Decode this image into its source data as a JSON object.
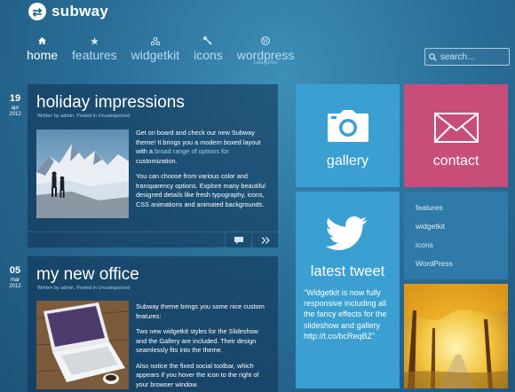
{
  "brand": {
    "name": "subway",
    "icon": "arrows-icon"
  },
  "nav": [
    {
      "label": "home",
      "sub": "",
      "icon": "home-icon"
    },
    {
      "label": "features",
      "sub": "",
      "icon": "star-icon"
    },
    {
      "label": "widgetkit",
      "sub": "",
      "icon": "widgetkit-icon"
    },
    {
      "label": "icons",
      "sub": "",
      "icon": "tools-icon"
    },
    {
      "label": "wordpress",
      "sub": "categories",
      "icon": "wordpress-icon"
    }
  ],
  "search": {
    "placeholder": "search..."
  },
  "posts": [
    {
      "day": "19",
      "month": "apr",
      "year": "2012",
      "title": "holiday impressions",
      "meta": "Written by admin. Posted in Uncategorized",
      "p1_a": "Get on board and check our new Subway theme! It brings you a modern boxed layout with a ",
      "p1_link": "broad range of options for",
      "p1_b": " customization.",
      "p2": "You can choose from various color and transparency options. Explore many beautiful designed details like fresh typography, icons, CSS animations and animated backgrounds."
    },
    {
      "day": "05",
      "month": "mar",
      "year": "2012",
      "title": "my new office",
      "meta": "Written by admin. Posted in Uncategorized",
      "p1": "Subway theme brings you some nice custom features:",
      "p2": "Two new widgetkit styles for the Slideshow and the Gallery are included. Their design seamlessly fits into the theme.",
      "p3": "Also notice the fixed social toolbar, which appears if you hover the icon to the right of your browser window."
    }
  ],
  "tiles": {
    "gallery": "gallery",
    "contact": "contact",
    "tweet_title": "latest tweet",
    "tweet_text": "\"Widgetkit is now fully responsive including all the fancy effects for the slideshow and gallery http://t.co/bcReqBZ\"",
    "links": [
      "features",
      "widgetkit",
      "icons",
      "WordPress"
    ]
  },
  "colors": {
    "gallery": "#3b9fd2",
    "contact": "#c94d79",
    "tweet": "#3b9fd2",
    "links": "#2f7aa9"
  }
}
